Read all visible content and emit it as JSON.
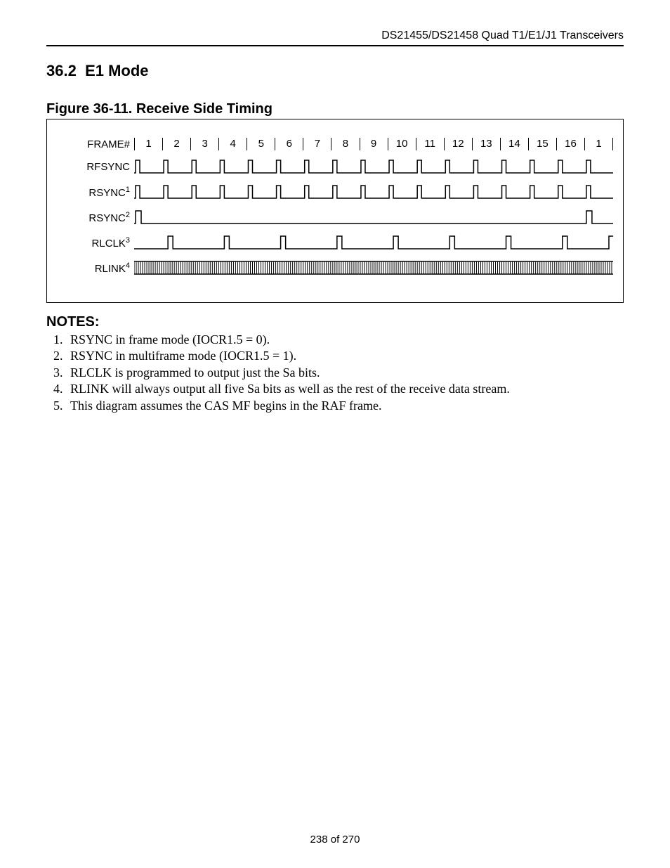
{
  "running_head": "DS21455/DS21458 Quad T1/E1/J1 Transceivers",
  "section_number": "36.2",
  "section_title": "E1 Mode",
  "figure_number": "Figure 36-11.",
  "figure_title": "Receive Side Timing",
  "signals": {
    "frame_label": "FRAME#",
    "frame_numbers": [
      "1",
      "2",
      "3",
      "4",
      "5",
      "6",
      "7",
      "8",
      "9",
      "10",
      "11",
      "12",
      "13",
      "14",
      "15",
      "16",
      "1"
    ],
    "rows": [
      {
        "label": "RFSYNC",
        "sup": ""
      },
      {
        "label": "RSYNC",
        "sup": "1"
      },
      {
        "label": "RSYNC",
        "sup": "2"
      },
      {
        "label": "RLCLK",
        "sup": "3"
      },
      {
        "label": "RLINK",
        "sup": "4"
      }
    ]
  },
  "notes_heading": "NOTES:",
  "notes": [
    "RSYNC in frame mode (IOCR1.5 = 0).",
    "RSYNC in multiframe mode (IOCR1.5 = 1).",
    "RLCLK is programmed to output just the Sa bits.",
    "RLINK will always output all five Sa bits as well as the rest of the receive data stream.",
    "This diagram assumes the CAS MF begins in the RAF frame."
  ],
  "page_current": "238",
  "page_total": "270",
  "page_of": "of"
}
